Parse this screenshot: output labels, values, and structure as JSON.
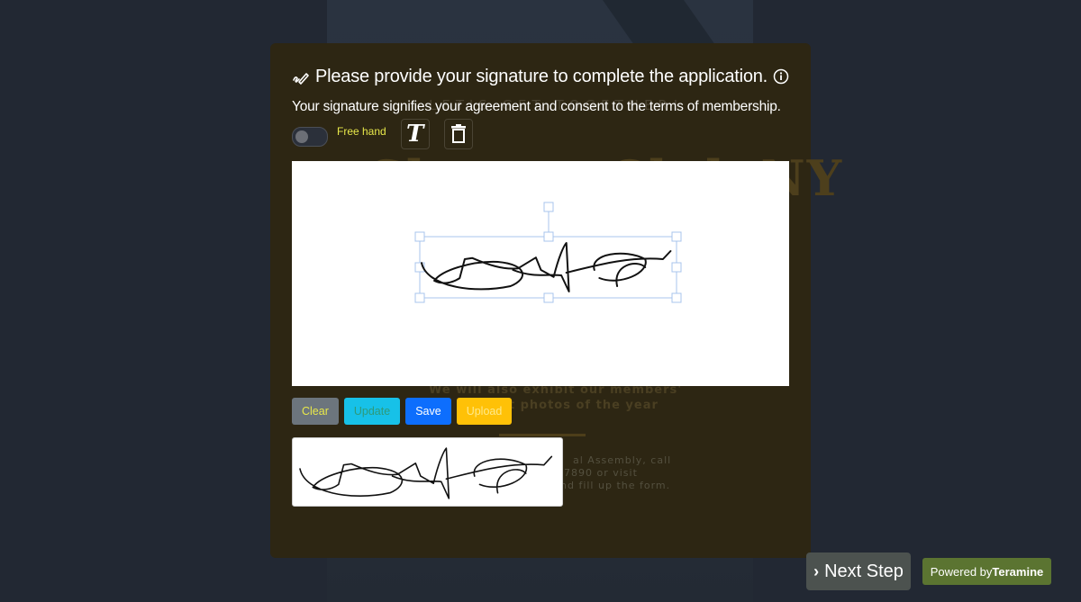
{
  "background": {
    "tagline": "LET'S GET TOGETHER!",
    "club_name": "Shutter Club NY",
    "exhibit_line1": "We will also exhibit our members'",
    "exhibit_line2": "best photos of the year",
    "info_line1": "al Assembly, call",
    "info_line2": "7890 or visit",
    "info_line3": "nd fill up the form."
  },
  "modal": {
    "title_icon": "signature-pen-icon",
    "title": "Please provide your signature to complete the application.",
    "info_icon": "info-circle-icon",
    "subtitle": "Your signature signifies your agreement and consent to the terms of membership.",
    "controls": {
      "toggle_on": false,
      "toggle_label": "Free hand",
      "text_tool_icon": "text-T-icon",
      "delete_tool_icon": "trash-icon"
    },
    "buttons": {
      "clear": "Clear",
      "update": "Update",
      "save": "Save",
      "upload": "Upload"
    },
    "colors": {
      "clear": "#6c757d",
      "update": "#17c1e8",
      "save": "#0d6efd",
      "upload": "#ffc107",
      "label_yellow": "#e8e84a"
    }
  },
  "footer": {
    "next_step_icon": "chevron-right-icon",
    "next_step": "Next Step",
    "powered_by": "Powered by",
    "brand": "Teramine",
    "brand_color": "#5b7431"
  }
}
